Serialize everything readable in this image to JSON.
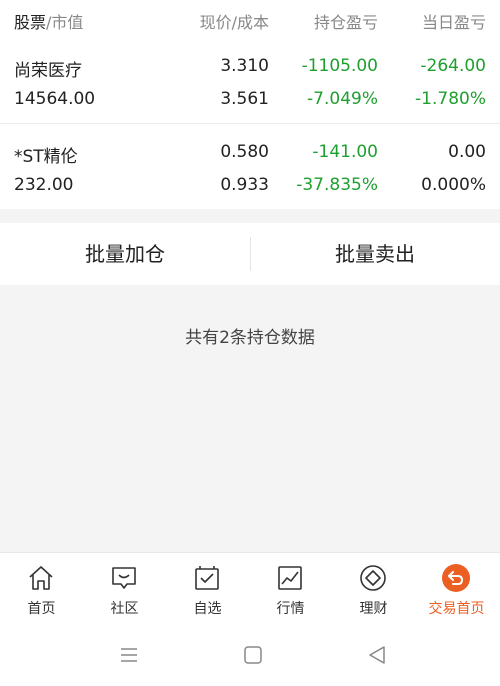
{
  "header": {
    "col1_main": "股票",
    "col1_sub": "/市值",
    "col2": "现价/成本",
    "col3": "持仓盈亏",
    "col4": "当日盈亏"
  },
  "holdings": [
    {
      "name": "尚荣医疗",
      "market_value": "14564.00",
      "price": "3.310",
      "cost": "3.561",
      "pl_amount": "-1105.00",
      "pl_percent": "-7.049%",
      "day_amount": "-264.00",
      "day_percent": "-1.780%"
    },
    {
      "name": "*ST精伦",
      "market_value": "232.00",
      "price": "0.580",
      "cost": "0.933",
      "pl_amount": "-141.00",
      "pl_percent": "-37.835%",
      "day_amount": "0.00",
      "day_percent": "0.000%"
    }
  ],
  "actions": {
    "batch_add": "批量加仓",
    "batch_sell": "批量卖出"
  },
  "summary": "共有2条持仓数据",
  "tabs": [
    {
      "label": "首页",
      "icon": "home-icon"
    },
    {
      "label": "社区",
      "icon": "chat-icon"
    },
    {
      "label": "自选",
      "icon": "watchlist-icon"
    },
    {
      "label": "行情",
      "icon": "chart-icon"
    },
    {
      "label": "理财",
      "icon": "diamond-icon"
    },
    {
      "label": "交易首页",
      "icon": "trade-icon",
      "active": true
    }
  ],
  "colors": {
    "loss": "#1ea02f",
    "accent": "#ec5f23"
  }
}
